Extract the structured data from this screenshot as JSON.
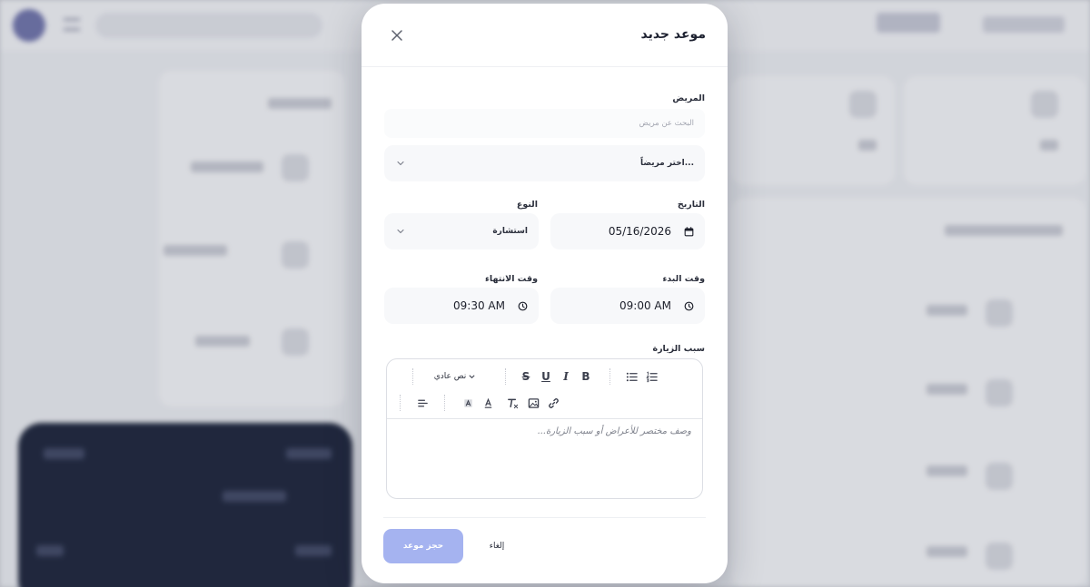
{
  "modal": {
    "title": "موعد جديد",
    "patient": {
      "label": "المريض",
      "search_placeholder": "البحث عن مريض",
      "select_value": "...اختر مريضاً"
    },
    "date": {
      "label": "التاريخ",
      "value": "05/16/2026"
    },
    "type": {
      "label": "النوع",
      "value": "استشارة"
    },
    "start_time": {
      "label": "وقت البدء",
      "value": "09:00 AM"
    },
    "end_time": {
      "label": "وقت الانتهاء",
      "value": "09:30 AM"
    },
    "reason": {
      "label": "سبب الزيارة",
      "header_select": "نص عادي",
      "placeholder": "وصف مختصر للأعراض أو سبب الزيارة..."
    },
    "footer": {
      "submit_label": "حجز موعد",
      "cancel_label": "إلغاء"
    }
  },
  "colors": {
    "primary_button": "#a5b3f0",
    "field_background": "#f7f8fa",
    "overlay_dark_card": "#141c33"
  }
}
